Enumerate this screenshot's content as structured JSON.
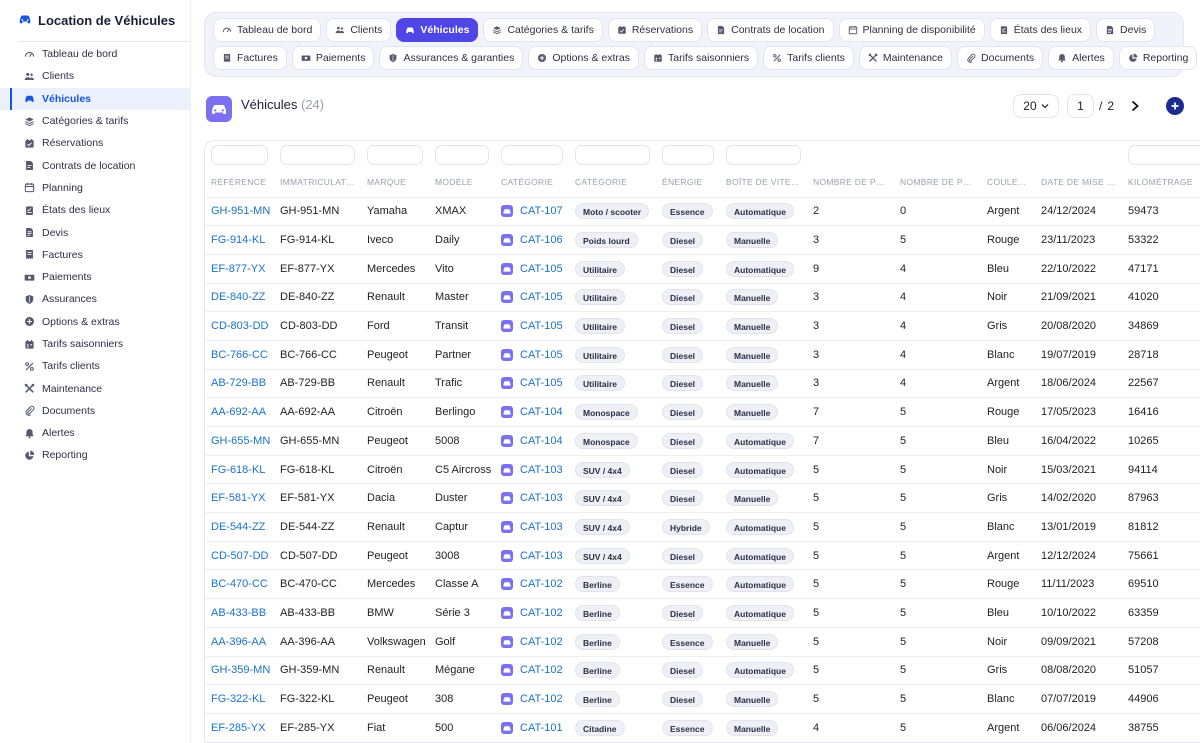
{
  "sidebar": {
    "app_title": "Location de Véhicules",
    "items": [
      {
        "label": "Tableau de bord",
        "icon": "gauge-icon"
      },
      {
        "label": "Clients",
        "icon": "users-icon"
      },
      {
        "label": "Véhicules",
        "icon": "car-icon",
        "active": true
      },
      {
        "label": "Catégories & tarifs",
        "icon": "layers-icon"
      },
      {
        "label": "Réservations",
        "icon": "calendar-check-icon"
      },
      {
        "label": "Contrats de location",
        "icon": "contract-icon"
      },
      {
        "label": "Planning",
        "icon": "calendar-icon"
      },
      {
        "label": "États des lieux",
        "icon": "checklist-icon"
      },
      {
        "label": "Devis",
        "icon": "document-icon"
      },
      {
        "label": "Factures",
        "icon": "invoice-icon"
      },
      {
        "label": "Paiements",
        "icon": "money-icon"
      },
      {
        "label": "Assurances",
        "icon": "shield-icon"
      },
      {
        "label": "Options & extras",
        "icon": "plus-circle-icon"
      },
      {
        "label": "Tarifs saisonniers",
        "icon": "calendar-grid-icon"
      },
      {
        "label": "Tarifs clients",
        "icon": "percent-icon"
      },
      {
        "label": "Maintenance",
        "icon": "tools-icon"
      },
      {
        "label": "Documents",
        "icon": "paperclip-icon"
      },
      {
        "label": "Alertes",
        "icon": "bell-icon"
      },
      {
        "label": "Reporting",
        "icon": "pie-chart-icon"
      }
    ]
  },
  "tabs": {
    "row1": [
      {
        "label": "Tableau de bord",
        "icon": "gauge-icon"
      },
      {
        "label": "Clients",
        "icon": "users-icon"
      },
      {
        "label": "Véhicules",
        "icon": "car-icon",
        "active": true
      },
      {
        "label": "Catégories & tarifs",
        "icon": "layers-icon"
      },
      {
        "label": "Réservations",
        "icon": "calendar-check-icon"
      },
      {
        "label": "Contrats de location",
        "icon": "contract-icon"
      },
      {
        "label": "Planning de disponibilité",
        "icon": "calendar-icon"
      },
      {
        "label": "États des lieux",
        "icon": "checklist-icon"
      },
      {
        "label": "Devis",
        "icon": "document-icon"
      }
    ],
    "row2": [
      {
        "label": "Factures",
        "icon": "invoice-icon"
      },
      {
        "label": "Paiements",
        "icon": "money-icon"
      },
      {
        "label": "Assurances & garanties",
        "icon": "shield-icon"
      },
      {
        "label": "Options & extras",
        "icon": "plus-circle-icon"
      },
      {
        "label": "Tarifs saisonniers",
        "icon": "calendar-grid-icon"
      },
      {
        "label": "Tarifs clients",
        "icon": "percent-icon"
      },
      {
        "label": "Maintenance",
        "icon": "tools-icon"
      },
      {
        "label": "Documents",
        "icon": "paperclip-icon"
      },
      {
        "label": "Alertes",
        "icon": "bell-icon"
      },
      {
        "label": "Reporting",
        "icon": "pie-chart-icon"
      }
    ]
  },
  "header": {
    "title": "Véhicules",
    "count": "(24)"
  },
  "pagination": {
    "per_page": "20",
    "current_page": "1",
    "separator": "/",
    "total_pages": "2"
  },
  "table": {
    "columns": [
      "Référence",
      "Immatriculation",
      "Marque",
      "Modèle",
      "Catégorie",
      "Catégorie",
      "Énergie",
      "Boîte de vitesses",
      "Nombre de places",
      "Nombre de portes",
      "Couleur",
      "Date de mise en circulation",
      "Kilométrage"
    ],
    "rows": [
      [
        "GH-951-MN",
        "GH-951-MN",
        "Yamaha",
        "XMAX",
        "CAT-107",
        "Moto / scooter",
        "Essence",
        "Automatique",
        "2",
        "0",
        "Argent",
        "24/12/2024",
        "59473"
      ],
      [
        "FG-914-KL",
        "FG-914-KL",
        "Iveco",
        "Daily",
        "CAT-106",
        "Poids lourd",
        "Diesel",
        "Manuelle",
        "3",
        "5",
        "Rouge",
        "23/11/2023",
        "53322"
      ],
      [
        "EF-877-YX",
        "EF-877-YX",
        "Mercedes",
        "Vito",
        "CAT-105",
        "Utilitaire",
        "Diesel",
        "Automatique",
        "9",
        "4",
        "Bleu",
        "22/10/2022",
        "47171"
      ],
      [
        "DE-840-ZZ",
        "DE-840-ZZ",
        "Renault",
        "Master",
        "CAT-105",
        "Utilitaire",
        "Diesel",
        "Manuelle",
        "3",
        "4",
        "Noir",
        "21/09/2021",
        "41020"
      ],
      [
        "CD-803-DD",
        "CD-803-DD",
        "Ford",
        "Transit",
        "CAT-105",
        "Utilitaire",
        "Diesel",
        "Manuelle",
        "3",
        "4",
        "Gris",
        "20/08/2020",
        "34869"
      ],
      [
        "BC-766-CC",
        "BC-766-CC",
        "Peugeot",
        "Partner",
        "CAT-105",
        "Utilitaire",
        "Diesel",
        "Manuelle",
        "3",
        "4",
        "Blanc",
        "19/07/2019",
        "28718"
      ],
      [
        "AB-729-BB",
        "AB-729-BB",
        "Renault",
        "Trafic",
        "CAT-105",
        "Utilitaire",
        "Diesel",
        "Manuelle",
        "3",
        "4",
        "Argent",
        "18/06/2024",
        "22567"
      ],
      [
        "AA-692-AA",
        "AA-692-AA",
        "Citroën",
        "Berlingo",
        "CAT-104",
        "Monospace",
        "Diesel",
        "Manuelle",
        "7",
        "5",
        "Rouge",
        "17/05/2023",
        "16416"
      ],
      [
        "GH-655-MN",
        "GH-655-MN",
        "Peugeot",
        "5008",
        "CAT-104",
        "Monospace",
        "Diesel",
        "Automatique",
        "7",
        "5",
        "Bleu",
        "16/04/2022",
        "10265"
      ],
      [
        "FG-618-KL",
        "FG-618-KL",
        "Citroën",
        "C5 Aircross",
        "CAT-103",
        "SUV / 4x4",
        "Diesel",
        "Automatique",
        "5",
        "5",
        "Noir",
        "15/03/2021",
        "94114"
      ],
      [
        "EF-581-YX",
        "EF-581-YX",
        "Dacia",
        "Duster",
        "CAT-103",
        "SUV / 4x4",
        "Diesel",
        "Manuelle",
        "5",
        "5",
        "Gris",
        "14/02/2020",
        "87963"
      ],
      [
        "DE-544-ZZ",
        "DE-544-ZZ",
        "Renault",
        "Captur",
        "CAT-103",
        "SUV / 4x4",
        "Hybride",
        "Automatique",
        "5",
        "5",
        "Blanc",
        "13/01/2019",
        "81812"
      ],
      [
        "CD-507-DD",
        "CD-507-DD",
        "Peugeot",
        "3008",
        "CAT-103",
        "SUV / 4x4",
        "Diesel",
        "Automatique",
        "5",
        "5",
        "Argent",
        "12/12/2024",
        "75661"
      ],
      [
        "BC-470-CC",
        "BC-470-CC",
        "Mercedes",
        "Classe A",
        "CAT-102",
        "Berline",
        "Essence",
        "Automatique",
        "5",
        "5",
        "Rouge",
        "11/11/2023",
        "69510"
      ],
      [
        "AB-433-BB",
        "AB-433-BB",
        "BMW",
        "Série 3",
        "CAT-102",
        "Berline",
        "Diesel",
        "Automatique",
        "5",
        "5",
        "Bleu",
        "10/10/2022",
        "63359"
      ],
      [
        "AA-396-AA",
        "AA-396-AA",
        "Volkswagen",
        "Golf",
        "CAT-102",
        "Berline",
        "Essence",
        "Manuelle",
        "5",
        "5",
        "Noir",
        "09/09/2021",
        "57208"
      ],
      [
        "GH-359-MN",
        "GH-359-MN",
        "Renault",
        "Mégane",
        "CAT-102",
        "Berline",
        "Diesel",
        "Automatique",
        "5",
        "5",
        "Gris",
        "08/08/2020",
        "51057"
      ],
      [
        "FG-322-KL",
        "FG-322-KL",
        "Peugeot",
        "308",
        "CAT-102",
        "Berline",
        "Diesel",
        "Manuelle",
        "5",
        "5",
        "Blanc",
        "07/07/2019",
        "44906"
      ],
      [
        "EF-285-YX",
        "EF-285-YX",
        "Fiat",
        "500",
        "CAT-101",
        "Citadine",
        "Essence",
        "Manuelle",
        "4",
        "5",
        "Argent",
        "06/06/2024",
        "38755"
      ]
    ]
  },
  "colors": {
    "accent": "#4f46e5",
    "link": "#1a73c8",
    "active_nav": "#1a56db",
    "header_icon": "#7c6ff0",
    "add_button": "#1c2b8f"
  }
}
